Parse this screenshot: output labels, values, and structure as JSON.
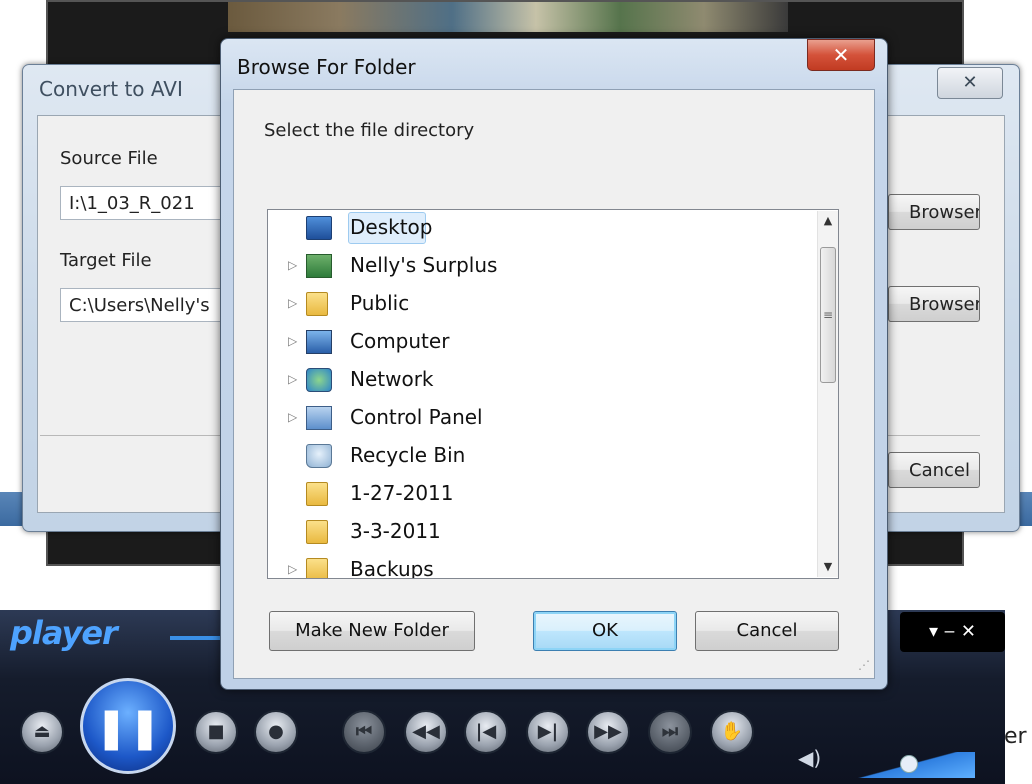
{
  "convert_dialog": {
    "title": "Convert to AVI",
    "close_glyph": "✕",
    "source_label": "Source File",
    "source_value": "I:\\1_03_R_021",
    "target_label": "Target File",
    "target_value": "C:\\Users\\Nelly's",
    "browser_button_1": "Browser",
    "browser_button_2": "Browser",
    "cancel_button": "Cancel"
  },
  "browse_dialog": {
    "title": "Browse For Folder",
    "close_glyph": "✕",
    "prompt": "Select the file directory",
    "tree": [
      {
        "label": "Desktop",
        "icon": "desktop-icon",
        "expander": "",
        "selected": true
      },
      {
        "label": "Nelly's Surplus",
        "icon": "user-folder-icon",
        "expander": "▷"
      },
      {
        "label": "Public",
        "icon": "folder-icon",
        "expander": "▷"
      },
      {
        "label": "Computer",
        "icon": "computer-icon",
        "expander": "▷"
      },
      {
        "label": "Network",
        "icon": "network-icon",
        "expander": "▷"
      },
      {
        "label": "Control Panel",
        "icon": "control-panel-icon",
        "expander": "▷"
      },
      {
        "label": "Recycle Bin",
        "icon": "recycle-bin-icon",
        "expander": ""
      },
      {
        "label": "1-27-2011",
        "icon": "folder-icon",
        "expander": ""
      },
      {
        "label": "3-3-2011",
        "icon": "folder-icon",
        "expander": ""
      },
      {
        "label": "Backups",
        "icon": "folder-icon",
        "expander": "▷"
      }
    ],
    "scroll_up_glyph": "▲",
    "scroll_down_glyph": "▼",
    "scroll_thumb_glyph": "≡",
    "make_new_folder_button": "Make New Folder",
    "ok_button": "OK",
    "cancel_button": "Cancel"
  },
  "player": {
    "logo": "player",
    "window_controls": "▾ ‒ ✕",
    "pause_glyph": "❚❚",
    "eject_glyph": "⏏",
    "stop_glyph": "■",
    "record_glyph": "●",
    "prev_chapter_glyph": "⏮",
    "rewind_glyph": "◀◀",
    "prev_glyph": "|◀",
    "next_glyph": "▶|",
    "forward_glyph": "▶▶",
    "next_chapter_glyph": "⏭",
    "hand_glyph": "✋",
    "volume_glyph": "◀)",
    "volume_level": 0.45,
    "partial_text": "er"
  }
}
